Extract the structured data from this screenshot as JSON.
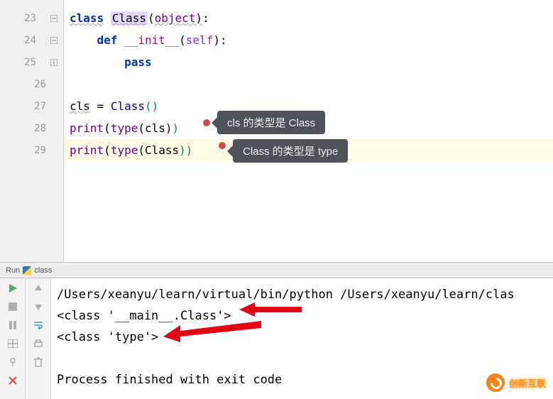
{
  "gutter": [
    "23",
    "24",
    "25",
    "26",
    "27",
    "28",
    "29"
  ],
  "code": {
    "l23": {
      "kw": "class",
      "sp": " ",
      "name": "Class",
      "lp": "(",
      "base": "object",
      "rp": ")",
      ":": ":"
    },
    "l24": {
      "indent": "    ",
      "kw": "def",
      "sp": " ",
      "fn": "__init__",
      "lp": "(",
      "self": "self",
      "rp": ")",
      ":": ":"
    },
    "l25": {
      "indent": "        ",
      "kw": "pass"
    },
    "l27": {
      "var": "cls",
      "eq": " = ",
      "cls": "Class",
      "lp": "(",
      "rp": ")"
    },
    "l28": {
      "fn": "print",
      "lp": "(",
      "ty": "type",
      "lp2": "(",
      "arg": "cls",
      "rp2": ")",
      "rp": ")"
    },
    "l29": {
      "fn": "print",
      "lp": "(",
      "ty": "type",
      "lp2": "(",
      "arg": "Class",
      "rp2": ")",
      "rp": ")"
    }
  },
  "callouts": {
    "c1": "cls 的类型是 Class",
    "c2": "Class 的类型是 type"
  },
  "run": {
    "label": "Run",
    "script": "class"
  },
  "console": {
    "l1": "/Users/xeanyu/learn/virtual/bin/python /Users/xeanyu/learn/clas",
    "l2": "<class '__main__.Class'>",
    "l3": "<class 'type'>",
    "l5": "Process finished with exit code"
  },
  "watermark": {
    "text": "创新互联"
  }
}
